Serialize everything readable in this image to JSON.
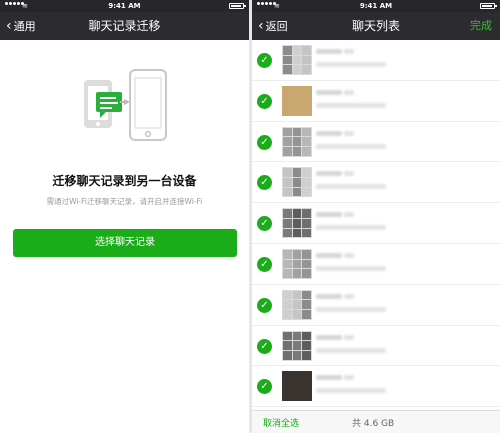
{
  "status": {
    "time": "9:41 AM"
  },
  "left": {
    "nav": {
      "back_label": "通用",
      "title": "聊天记录迁移"
    },
    "heading": "迁移聊天记录到另一台设备",
    "subtext": "需通过Wi-Fi迁移聊天记录，请开启并连接Wi-Fi",
    "button_label": "选择聊天记录"
  },
  "right": {
    "nav": {
      "back_label": "返回",
      "title": "聊天列表",
      "done_label": "完成"
    },
    "rows": 9,
    "footer": {
      "deselect_label": "取消全选",
      "total_label": "共 4.6 GB"
    }
  },
  "colors": {
    "accent": "#1aad19",
    "navbar": "#2b2b30"
  }
}
